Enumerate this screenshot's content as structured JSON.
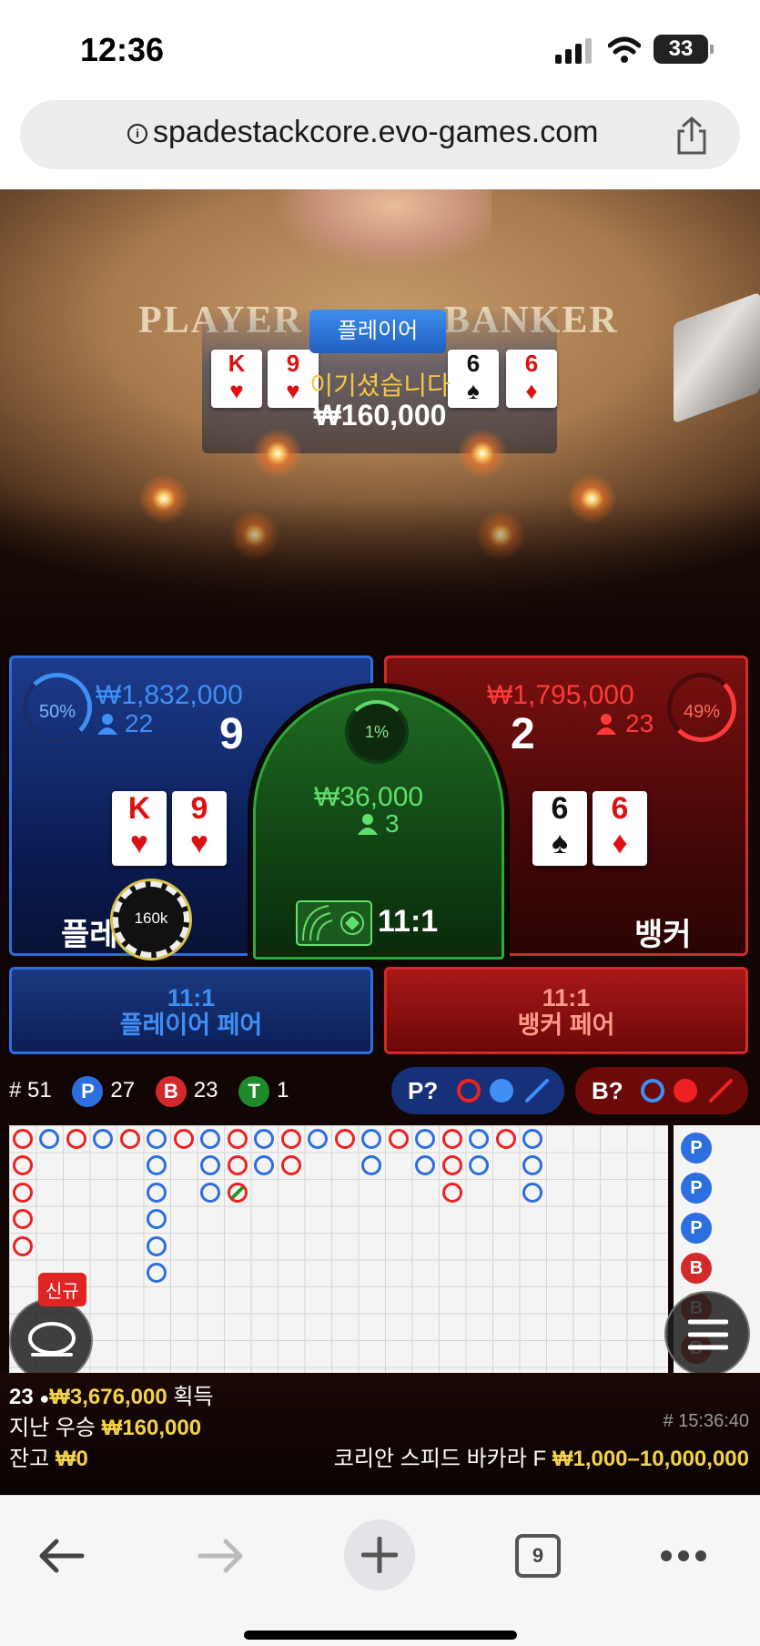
{
  "status_bar": {
    "time": "12:36",
    "battery": "33"
  },
  "browser": {
    "url": "spadestackcore.evo-games.com",
    "tab_count": "9"
  },
  "video": {
    "felt_left": "PLAYER",
    "felt_right": "BANKER",
    "result_tab": "플레이어",
    "win_message": "이기셨습니다",
    "win_amount": "₩160,000",
    "cards_player": [
      {
        "rank": "K",
        "suit": "♥"
      },
      {
        "rank": "9",
        "suit": "♥"
      }
    ],
    "cards_banker": [
      {
        "rank": "6",
        "suit": "♠"
      },
      {
        "rank": "6",
        "suit": "♦"
      }
    ]
  },
  "player": {
    "percent": "50%",
    "amount": "₩1,832,000",
    "count": "22",
    "score": "9",
    "label": "플레이어",
    "cards": [
      {
        "rank": "K",
        "suit": "♥"
      },
      {
        "rank": "9",
        "suit": "♥"
      }
    ],
    "chip": "160k"
  },
  "tie": {
    "percent": "1%",
    "amount": "₩36,000",
    "count": "3",
    "payout": "11:1"
  },
  "banker": {
    "percent": "49%",
    "amount": "₩1,795,000",
    "count": "23",
    "score": "2",
    "label": "뱅커",
    "cards": [
      {
        "rank": "6",
        "suit": "♠"
      },
      {
        "rank": "6",
        "suit": "♦"
      }
    ]
  },
  "pairs": {
    "player_odds": "11:1",
    "player_label": "플레이어 페어",
    "banker_odds": "11:1",
    "banker_label": "뱅커 페어"
  },
  "stats": {
    "rounds_prefix": "#",
    "rounds": "51",
    "p_badge": "P",
    "p": "27",
    "b_badge": "B",
    "b": "23",
    "t_badge": "T",
    "t": "1"
  },
  "predict": {
    "player": "P?",
    "banker": "B?"
  },
  "road": {
    "columns": [
      [
        "B",
        "B",
        "B",
        "B",
        "B"
      ],
      [
        "P"
      ],
      [
        "B"
      ],
      [
        "P"
      ],
      [
        "B"
      ],
      [
        "P",
        "P",
        "P",
        "P",
        "P",
        "P"
      ],
      [
        "B"
      ],
      [
        "P",
        "P",
        "P"
      ],
      [
        "B",
        "B",
        "T"
      ],
      [
        "P",
        "P"
      ],
      [
        "B",
        "B"
      ],
      [
        "P"
      ],
      [
        "B"
      ],
      [
        "P",
        "P"
      ],
      [
        "B"
      ],
      [
        "P",
        "P"
      ],
      [
        "B",
        "B",
        "B"
      ],
      [
        "P",
        "P"
      ],
      [
        "B"
      ],
      [
        "P",
        "P",
        "P"
      ]
    ],
    "bead": [
      "P",
      "P",
      "P",
      "B",
      "B",
      "B"
    ]
  },
  "new_tag": "신규",
  "footer": {
    "players": "23",
    "total_win": "₩3,676,000",
    "win_word": "획득",
    "last_win_label": "지난 우승",
    "last_win": "₩160,000",
    "balance_label": "잔고",
    "balance": "₩0",
    "game_id": "# 15:36:40",
    "table_name": "코리안 스피드 바카라 F",
    "limits": "₩1,000–10,000,000"
  },
  "colors": {
    "player": "#2d6fe0",
    "banker": "#d22a2a",
    "tie": "#2fa83a",
    "gold": "#f2d24a"
  }
}
